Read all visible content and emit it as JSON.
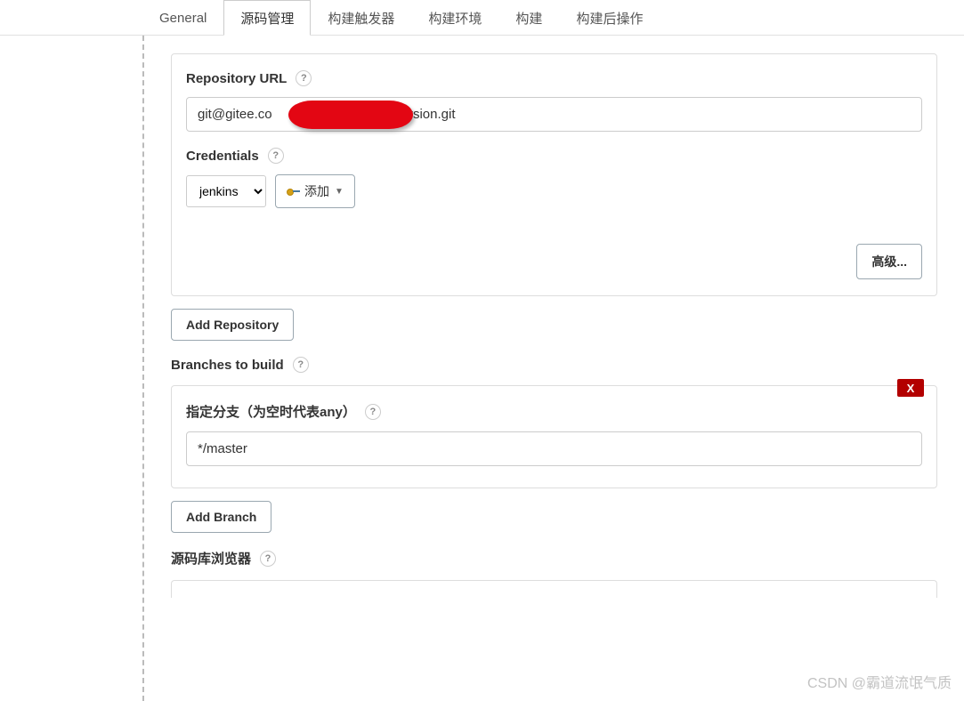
{
  "tabs": [
    {
      "label": "General"
    },
    {
      "label": "源码管理"
    },
    {
      "label": "构建触发器"
    },
    {
      "label": "构建环境"
    },
    {
      "label": "构建"
    },
    {
      "label": "构建后操作"
    }
  ],
  "repo": {
    "url_label": "Repository URL",
    "url_value_prefix": "git@gitee.co",
    "url_value_suffix": "version.git",
    "credentials_label": "Credentials",
    "credentials_selected": "jenkins",
    "add_cred_label": "添加",
    "advanced_label": "高级...",
    "add_repo_label": "Add Repository"
  },
  "branches": {
    "section_label": "Branches to build",
    "branch_spec_label": "指定分支（为空时代表any）",
    "branch_value": "*/master",
    "add_branch_label": "Add Branch",
    "delete_label": "X"
  },
  "browser": {
    "label": "源码库浏览器"
  },
  "help_glyph": "?",
  "watermark": "CSDN @霸道流氓气质"
}
